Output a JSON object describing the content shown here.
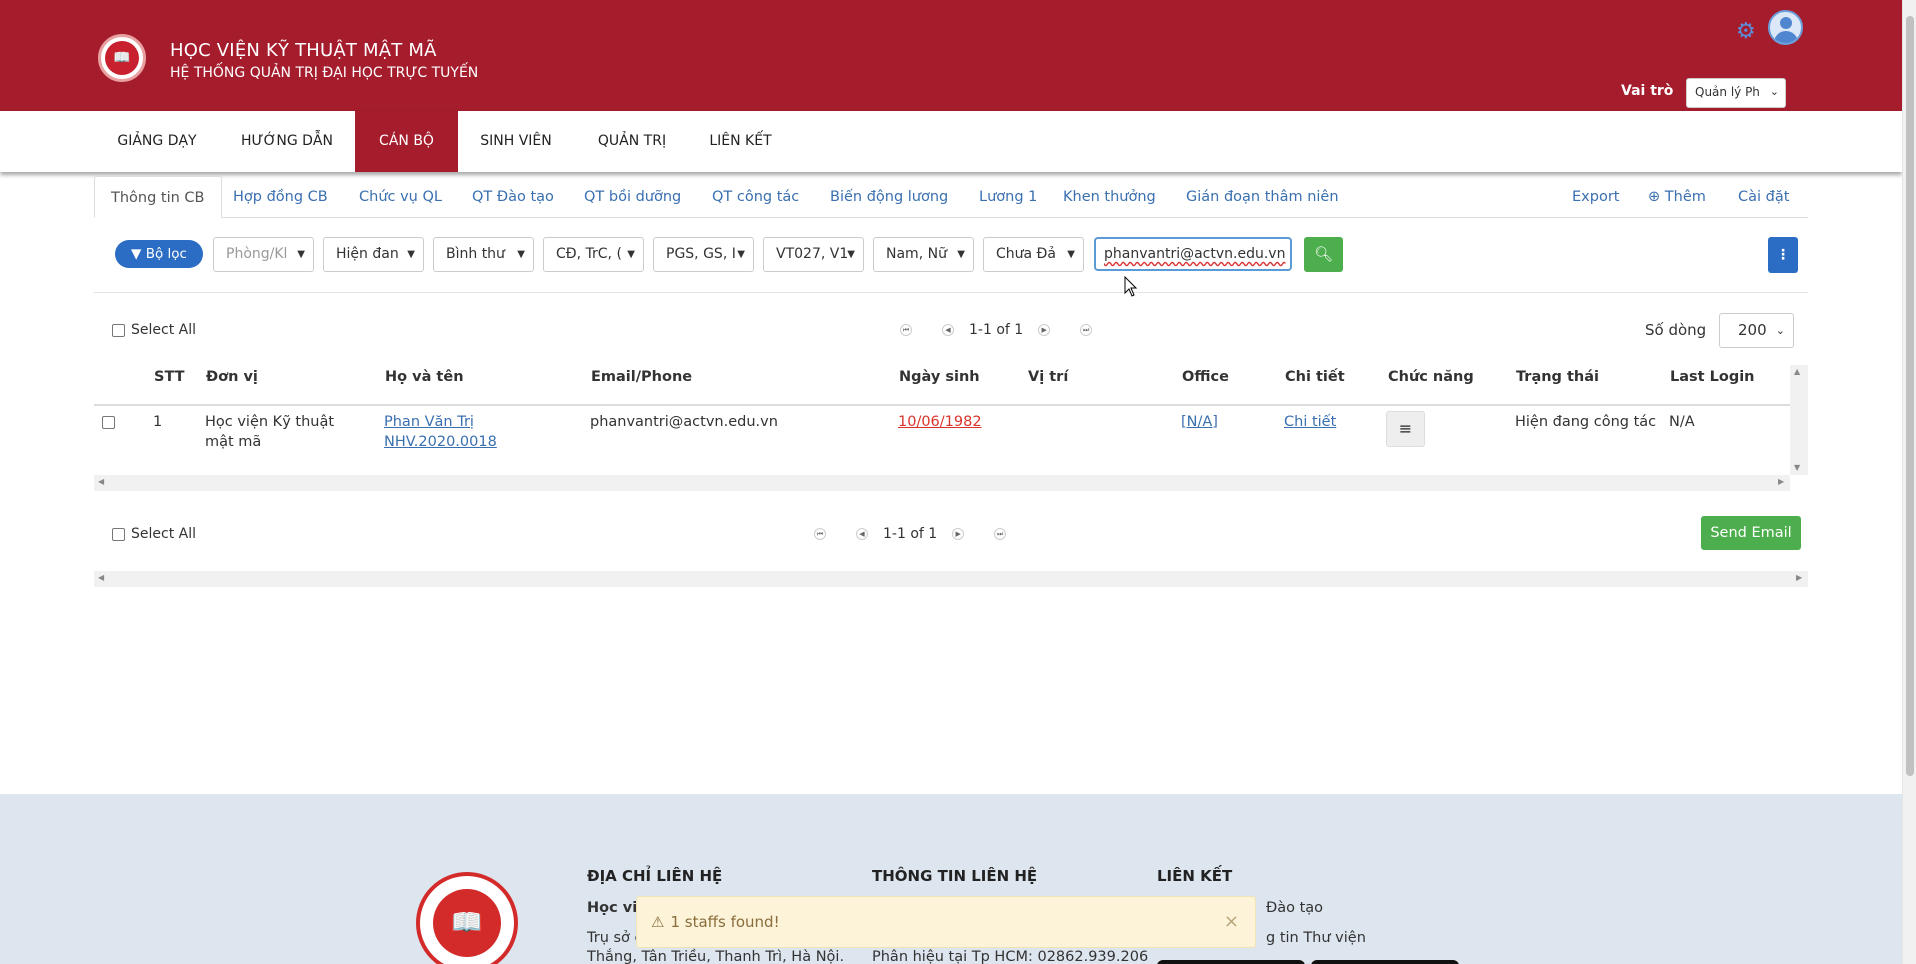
{
  "header": {
    "title": "HỌC VIỆN KỸ THUẬT MẬT MÃ",
    "subtitle": "HỆ THỐNG QUẢN TRỊ ĐẠI HỌC TRỰC TUYẾN",
    "role_label": "Vai trò",
    "role_value": "Quản lý Ph",
    "icons": [
      "gear-icon",
      "user-avatar-icon"
    ]
  },
  "mainnav": [
    "GIẢNG DẠY",
    "HƯỚNG DẪN",
    "CÁN BỘ",
    "SINH VIÊN",
    "QUẢN TRỊ",
    "LIÊN KẾT"
  ],
  "subtabs": [
    "Thông tin CB",
    "Hợp đồng CB",
    "Chức vụ QL",
    "QT Đào tạo",
    "QT bồi dưỡng",
    "QT công tác",
    "Biến động lương",
    "Lương 1",
    "Khen thưởng",
    "Gián đoạn thâm niên"
  ],
  "actions": {
    "export": "Export",
    "add": "Thêm",
    "settings": "Cài đặt"
  },
  "filters": {
    "button": "Bộ lọc",
    "dropdowns": [
      "Phòng/Kl",
      "Hiện đan",
      "Bình thư",
      "CĐ, TrC, (",
      "PGS, GS, I",
      "VT027, V1",
      "Nam, Nữ",
      "Chưa Đả"
    ],
    "email_value": "phanvantri@actvn.edu.vn"
  },
  "pagination": {
    "select_all": "Select All",
    "range": "1-1 of 1",
    "rows_label": "Số dòng",
    "rows_value": "200"
  },
  "table": {
    "columns": [
      "STT",
      "Đơn vị",
      "Họ và tên",
      "Email/Phone",
      "Ngày sinh",
      "Vị trí",
      "Office",
      "Chi tiết",
      "Chức năng",
      "Trạng thái",
      "Last Login"
    ],
    "rows": [
      {
        "stt": "1",
        "don_vi": "Học viện Kỹ thuật mật mã",
        "ho_ten": "Phan Văn Trị",
        "ma": "NHV.2020.0018",
        "email": "phanvantri@actvn.edu.vn",
        "ngay_sinh": "10/06/1982",
        "vi_tri": "",
        "office": "[N/A]",
        "chi_tiet": "Chi tiết",
        "trang_thai": "Hiện đang công tác",
        "last_login": "N/A"
      }
    ]
  },
  "send_email": "Send Email",
  "footer": {
    "col1_title": "ĐỊA CHỈ LIÊN HỆ",
    "col1_line1": "Học việ",
    "col1_line2": "Trụ sở c",
    "col1_line3": "Thắng, Tân Triều, Thanh Trì, Hà Nội.",
    "col2_title": "THÔNG TIN LIÊN HỆ",
    "col2_line3": "Phân hiệu tại Tp HCM: 02862.939.206",
    "col3_title": "LIÊN KẾT",
    "col3_line1": "Đào tạo",
    "col3_line2": "g tin Thư viện"
  },
  "toast": {
    "message": "1 staffs found!"
  },
  "colors": {
    "brand": "#a51c2d",
    "primary": "#2b6cc4",
    "success": "#4cae4c",
    "link": "#3a6fb0"
  }
}
